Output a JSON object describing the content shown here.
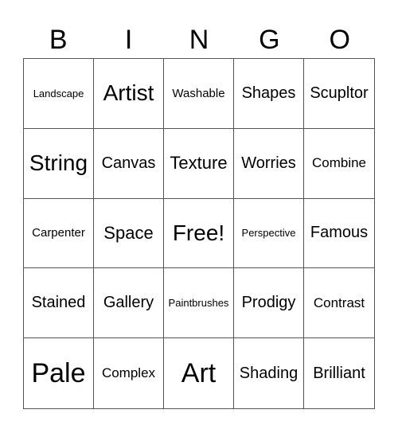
{
  "header": [
    "B",
    "I",
    "N",
    "G",
    "O"
  ],
  "cells": [
    {
      "text": "Landscape",
      "size": "s1"
    },
    {
      "text": "Artist",
      "size": "s6"
    },
    {
      "text": "Washable",
      "size": "s2"
    },
    {
      "text": "Shapes",
      "size": "s4"
    },
    {
      "text": "Scupltor",
      "size": "s4"
    },
    {
      "text": "String",
      "size": "s6"
    },
    {
      "text": "Canvas",
      "size": "s4"
    },
    {
      "text": "Texture",
      "size": "s5"
    },
    {
      "text": "Worries",
      "size": "s4"
    },
    {
      "text": "Combine",
      "size": "s3"
    },
    {
      "text": "Carpenter",
      "size": "s2"
    },
    {
      "text": "Space",
      "size": "s5"
    },
    {
      "text": "Free!",
      "size": "s6"
    },
    {
      "text": "Perspective",
      "size": "s1"
    },
    {
      "text": "Famous",
      "size": "s4"
    },
    {
      "text": "Stained",
      "size": "s4"
    },
    {
      "text": "Gallery",
      "size": "s4"
    },
    {
      "text": "Paintbrushes",
      "size": "s1"
    },
    {
      "text": "Prodigy",
      "size": "s4"
    },
    {
      "text": "Contrast",
      "size": "s3"
    },
    {
      "text": "Pale",
      "size": "s7"
    },
    {
      "text": "Complex",
      "size": "s3"
    },
    {
      "text": "Art",
      "size": "s7"
    },
    {
      "text": "Shading",
      "size": "s4"
    },
    {
      "text": "Brilliant",
      "size": "s4"
    }
  ]
}
